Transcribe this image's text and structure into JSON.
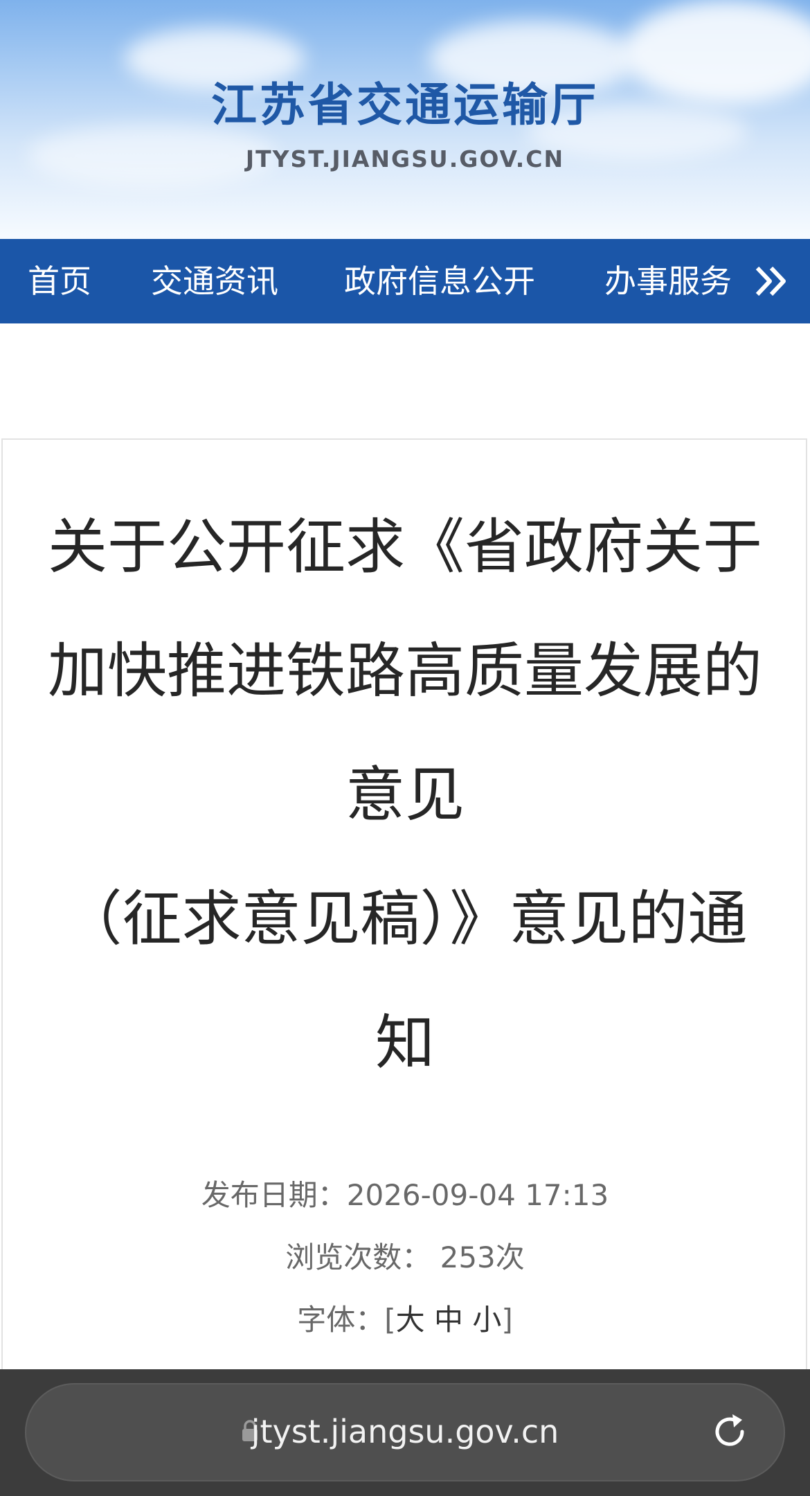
{
  "header": {
    "site_title": "江苏省交通运输厅",
    "site_domain": "JTYST.JIANGSU.GOV.CN"
  },
  "nav": {
    "items": [
      "首页",
      "交通资讯",
      "政府信息公开",
      "办事服务"
    ]
  },
  "article": {
    "title_lines": [
      "关于公开征求《省政府关于",
      "加快推进铁路高质量发展的",
      "意见",
      "（征求意见稿）》意见的通",
      "知"
    ],
    "publish_label": "发布日期：",
    "publish_date": "2026-09-04 17:13",
    "views_label": "浏览次数：",
    "views_value": "253次",
    "font_label": "字体：",
    "font_open": "[",
    "font_large": "大",
    "font_medium": "中",
    "font_small": "小",
    "font_close": "]"
  },
  "browser": {
    "url": "jtyst.jiangsu.gov.cn"
  }
}
